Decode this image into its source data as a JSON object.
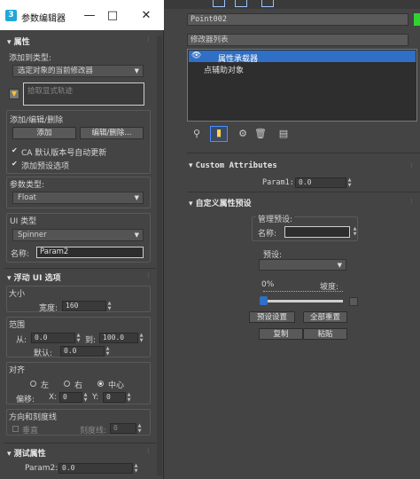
{
  "dialog": {
    "title": "参数编辑器",
    "logo_text": "3",
    "minimize_glyph": "—",
    "maximize_glyph": "□",
    "close_glyph": "✕",
    "attributes": {
      "header": "属性",
      "add_to_type_label": "添加到类型:",
      "add_to_type_value": "选定对象的当前修改器",
      "pick_track_placeholder": "拾取显式轨迹",
      "add_edit_delete_label": "添加/编辑/删除",
      "add_button": "添加",
      "edit_delete_button": "编辑/删除...",
      "ca_auto_update_label": "CA 默认版本号自动更新",
      "add_preset_label": "添加预设选项",
      "param_type_label": "参数类型:",
      "param_type_value": "Float",
      "ui_type_label": "UI 类型",
      "ui_type_value": "Spinner",
      "name_label": "名称:",
      "name_value": "Param2"
    },
    "float_ui": {
      "header": "浮动 UI 选项",
      "size_label": "大小",
      "width_label": "宽度:",
      "width_value": "160",
      "range_label": "范围",
      "from_label": "从:",
      "from_value": "0.0",
      "to_label": "到:",
      "to_value": "100.0",
      "default_label": "默认:",
      "default_value": "0.0",
      "align_label": "对齐",
      "align_left": "左",
      "align_right": "右",
      "align_center": "中心",
      "offset_label": "偏移:",
      "x_label": "X:",
      "x_value": "0",
      "y_label": "Y:",
      "y_value": "0",
      "orientation_label": "方向和刻度线",
      "vertical_label": "垂直",
      "ticks_label": "刻度线:",
      "ticks_value": "0"
    },
    "test_attr": {
      "header": "测试属性",
      "param_label": "Param2:",
      "param_value": "0.0"
    }
  },
  "right_panel": {
    "object_name": "Point002",
    "modifier_list_label": "修改器列表",
    "stack": [
      {
        "label": "属性承载器"
      },
      {
        "label": "点辅助对象"
      }
    ],
    "custom_attributes_header": "Custom Attributes",
    "param1_label": "Param1:",
    "param1_value": "0.0",
    "custom_preset_header": "自定义属性预设",
    "manage_presets_label": "管理预设:",
    "name_label": "名称:",
    "preset_label": "预设:",
    "percent_label": "0%",
    "slope_label": "坡度:",
    "set_preset_button": "预设设置",
    "reset_all_button": "全部重置",
    "copy_button": "复制",
    "paste_button": "粘贴"
  },
  "colors": {
    "accent_blue": "#2f6fc6",
    "dialog_title_bg": "#ffffff",
    "panel_bg": "#444444",
    "green_swatch": "#2fd32f"
  }
}
